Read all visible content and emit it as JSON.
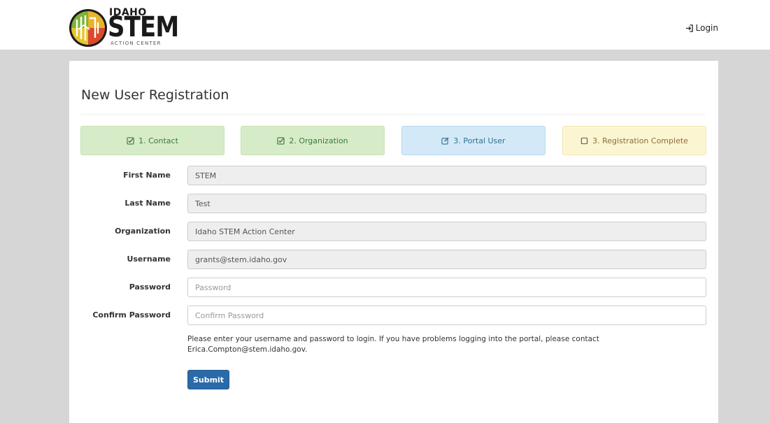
{
  "header": {
    "logo": {
      "top_text": "IDAHO",
      "main_text": "STEM",
      "sub_text": "ACTION CENTER",
      "icon": "idaho-stem-globe-logo"
    },
    "login": {
      "label": "Login",
      "icon": "sign-in-icon"
    }
  },
  "page": {
    "title": "New User Registration"
  },
  "steps": [
    {
      "label": "1. Contact",
      "state": "done",
      "icon": "check-square-icon"
    },
    {
      "label": "2. Organization",
      "state": "done",
      "icon": "check-square-icon"
    },
    {
      "label": "3. Portal User",
      "state": "active",
      "icon": "edit-icon"
    },
    {
      "label": "3. Registration Complete",
      "state": "pending",
      "icon": "empty-square-icon"
    }
  ],
  "form": {
    "first_name": {
      "label": "First Name",
      "value": "STEM",
      "placeholder": ""
    },
    "last_name": {
      "label": "Last Name",
      "value": "Test",
      "placeholder": ""
    },
    "organization": {
      "label": "Organization",
      "value": "Idaho STEM Action Center",
      "placeholder": ""
    },
    "username": {
      "label": "Username",
      "value": "grants@stem.idaho.gov",
      "placeholder": ""
    },
    "password": {
      "label": "Password",
      "value": "",
      "placeholder": "Password"
    },
    "confirm_password": {
      "label": "Confirm Password",
      "value": "",
      "placeholder": "Confirm Password"
    }
  },
  "help_text": "Please enter your username and password to login. If you have problems logging into the portal, please contact Erica.Compton@stem.idaho.gov.",
  "submit_label": "Submit",
  "colors": {
    "step_done_bg": "#d6ecc8",
    "step_active_bg": "#d4e9f7",
    "step_pending_bg": "#fcf5d2",
    "primary_button": "#2b6aa8"
  }
}
